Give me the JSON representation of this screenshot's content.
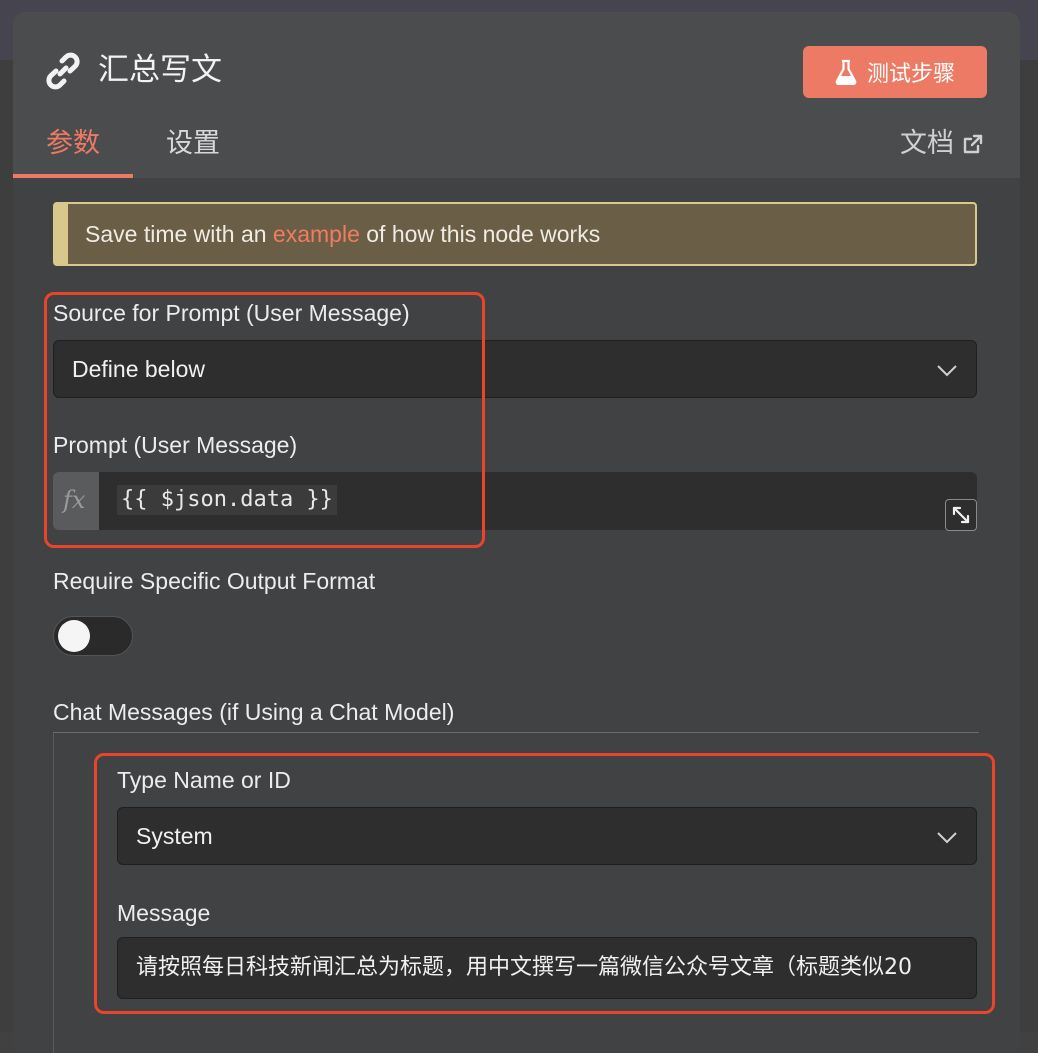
{
  "node": {
    "title": "汇总写文",
    "test_button_label": "测试步骤"
  },
  "tabs": [
    {
      "label": "参数",
      "active": true
    },
    {
      "label": "设置",
      "active": false
    }
  ],
  "docs_link_label": "文档",
  "notice": {
    "prefix": "Save time with an ",
    "link": "example",
    "suffix": " of how this node works"
  },
  "fields": {
    "prompt_source": {
      "label": "Source for Prompt (User Message)",
      "value": "Define below"
    },
    "prompt": {
      "label": "Prompt (User Message)",
      "fx_label": "fx",
      "value": "{{ $json.data }}"
    },
    "require_output_format": {
      "label": "Require Specific Output Format",
      "enabled": false
    },
    "chat_messages": {
      "label": "Chat Messages (if Using a Chat Model)",
      "type": {
        "label": "Type Name or ID",
        "value": "System"
      },
      "message": {
        "label": "Message",
        "value": "请按照每日科技新闻汇总为标题，用中文撰写一篇微信公众号文章（标题类似20"
      }
    }
  },
  "colors": {
    "accent": "#ec7a64",
    "highlight_border": "#e8452a",
    "notice_bg": "#6a5e47",
    "notice_border": "#d9c88c"
  },
  "icons": {
    "title": "link-icon",
    "test_button": "flask-icon",
    "docs": "external-link-icon",
    "dropdown": "chevron-down-icon",
    "expand": "expand-icon"
  }
}
